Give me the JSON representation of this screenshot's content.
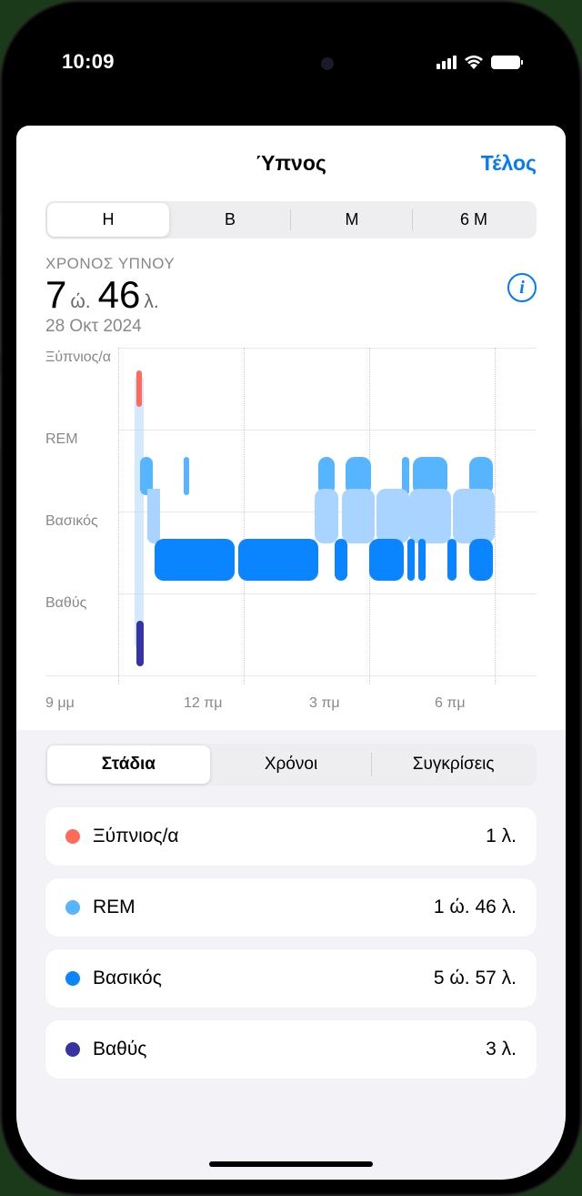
{
  "status": {
    "time": "10:09"
  },
  "header": {
    "title": "Ύπνος",
    "done": "Τέλος"
  },
  "range": [
    "Η",
    "B",
    "M",
    "6 M"
  ],
  "summary": {
    "label": "ΧΡΟΝΟΣ ΥΠΝΟΥ",
    "hours_num": "7",
    "hours_unit": "ώ.",
    "mins_num": "46",
    "mins_unit": "λ.",
    "date": "28 Οκτ 2024"
  },
  "chart_data": {
    "type": "hypnogram",
    "stages": [
      "Ξύπνιος/α",
      "REM",
      "Βασικός",
      "Βαθύς"
    ],
    "xticks": [
      "9 μμ",
      "12 πμ",
      "3 πμ",
      "6 πμ"
    ],
    "x_range_hours": [
      21,
      31
    ],
    "colors": {
      "awake": "#ff6b5b",
      "rem": "#57b4ff",
      "core": "#0a84ff",
      "deep": "#3634a3",
      "connect": "#a8d4ff"
    },
    "segments": [
      {
        "stage": "Ξύπνιος/α",
        "start": 22.0,
        "end": 22.02
      },
      {
        "stage": "Βαθύς",
        "start": 22.02,
        "end": 22.1
      },
      {
        "stage": "REM",
        "start": 22.1,
        "end": 22.3
      },
      {
        "stage": "Βασικός",
        "start": 22.3,
        "end": 24.0
      },
      {
        "stage": "REM",
        "start": 23.1,
        "end": 23.15
      },
      {
        "stage": "Βασικός",
        "start": 24.0,
        "end": 26.0
      },
      {
        "stage": "REM",
        "start": 26.0,
        "end": 26.4
      },
      {
        "stage": "Βασικός",
        "start": 26.4,
        "end": 26.7
      },
      {
        "stage": "REM",
        "start": 26.7,
        "end": 27.0
      },
      {
        "stage": "Βασικός",
        "start": 27.0,
        "end": 27.3
      },
      {
        "stage": "REM",
        "start": 27.3,
        "end": 28.1
      },
      {
        "stage": "Βασικός",
        "start": 27.5,
        "end": 27.8
      },
      {
        "stage": "Βασικός",
        "start": 28.1,
        "end": 28.4
      },
      {
        "stage": "REM",
        "start": 28.4,
        "end": 28.8
      },
      {
        "stage": "Βασικός",
        "start": 28.8,
        "end": 29.1
      }
    ]
  },
  "tabs": [
    "Στάδια",
    "Χρόνοι",
    "Συγκρίσεις"
  ],
  "stages_list": [
    {
      "name": "Ξύπνιος/α",
      "value": "1 λ.",
      "color": "#ff6b5b"
    },
    {
      "name": "REM",
      "value": "1 ώ. 46 λ.",
      "color": "#57b4ff"
    },
    {
      "name": "Βασικός",
      "value": "5 ώ. 57 λ.",
      "color": "#0a84ff"
    },
    {
      "name": "Βαθύς",
      "value": "3 λ.",
      "color": "#3634a3"
    }
  ]
}
